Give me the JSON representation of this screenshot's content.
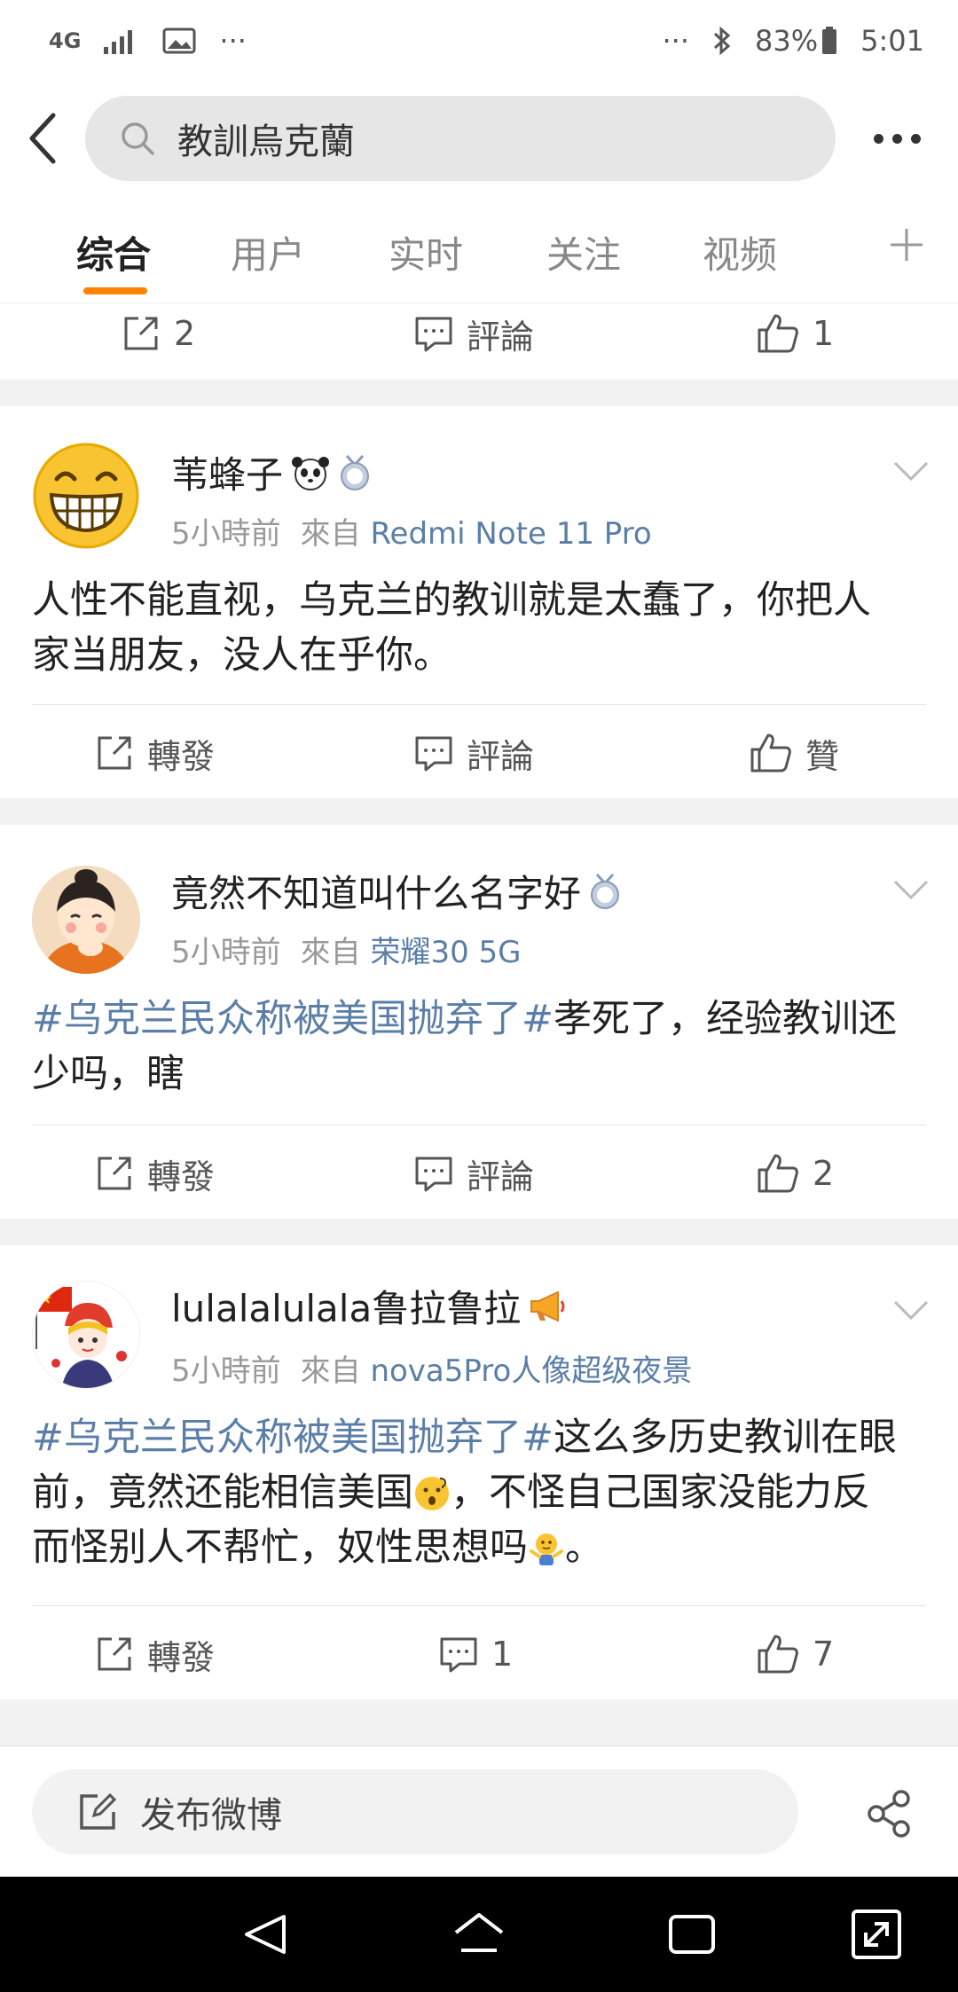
{
  "status_bar": {
    "network": "4G",
    "more": "···",
    "right_more": "···",
    "battery": "83%",
    "time": "5:01"
  },
  "search": {
    "query": "教訓烏克蘭"
  },
  "tabs": [
    "综合",
    "用户",
    "实时",
    "关注",
    "视频"
  ],
  "top_actions": {
    "repost": "2",
    "comment": "評論",
    "like": "1"
  },
  "posts": [
    {
      "username": "苇蜂子",
      "time": "5小時前",
      "from": "來自",
      "source": "Redmi Note 11 Pro",
      "line1": "人性不能直视，乌克兰的教训就是太蠢了，你把人",
      "line2": "家当朋友，没人在乎你。",
      "repost": "轉發",
      "comment": "評論",
      "like": "贊"
    },
    {
      "username": "竟然不知道叫什么名字好",
      "time": "5小時前",
      "from": "來自",
      "source": "荣耀30 5G",
      "topic": "#乌克兰民众称被美国抛弃了#",
      "line1": "孝死了，经验教训还",
      "line2": "少吗，瞎",
      "repost": "轉發",
      "comment": "評論",
      "like": "2"
    },
    {
      "username": "lulalalulala鲁拉鲁拉",
      "time": "5小時前",
      "from": "來自",
      "source": "nova5Pro人像超级夜景",
      "topic": "#乌克兰民众称被美国抛弃了#",
      "line1": "这么多历史教训在眼",
      "line2a": "前，竟然还能相信美国",
      "line2b": "，不怪自己国家没能力反",
      "line3": "而怪别人不帮忙，奴性思想吗",
      "line3end": "。",
      "repost": "轉發",
      "comment": "1",
      "like": "7"
    }
  ],
  "compose": {
    "label": "发布微博"
  },
  "colors": {
    "accent": "#ff8200",
    "link": "#5b7ea8",
    "separator": "#f2f2f2"
  }
}
